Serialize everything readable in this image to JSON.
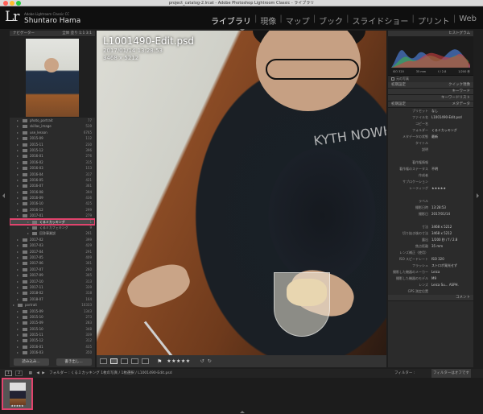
{
  "window": {
    "title": "project_catalog-2.lrcat - Adobe Photoshop Lightroom Classic - ライブラリ"
  },
  "identity": {
    "app_name": "Adobe Lightroom Classic CC",
    "user_name": "Shuntaro Hama"
  },
  "modules": [
    {
      "label": "ライブラリ",
      "active": true
    },
    {
      "label": "現像",
      "active": false
    },
    {
      "label": "マップ",
      "active": false
    },
    {
      "label": "ブック",
      "active": false
    },
    {
      "label": "スライドショー",
      "active": false
    },
    {
      "label": "プリント",
      "active": false
    },
    {
      "label": "Web",
      "active": false
    }
  ],
  "navigator": {
    "title": "ナビゲーター",
    "fit": "全体",
    "fill": "塗り",
    "one": "1:1",
    "zoom": "3:1"
  },
  "folders": [
    {
      "name": "photo_portrait",
      "count": "77",
      "level": 1
    },
    {
      "name": "skillas_image",
      "count": "519",
      "level": 1
    },
    {
      "name": "use_lesson",
      "count": "6765",
      "level": 1
    },
    {
      "name": "2015-09",
      "count": "112",
      "level": 1
    },
    {
      "name": "2015-11",
      "count": "230",
      "level": 1
    },
    {
      "name": "2015-12",
      "count": "396",
      "level": 1
    },
    {
      "name": "2016-01",
      "count": "276",
      "level": 1
    },
    {
      "name": "2016-02",
      "count": "315",
      "level": 1
    },
    {
      "name": "2016-03",
      "count": "153",
      "level": 1
    },
    {
      "name": "2016-04",
      "count": "317",
      "level": 1
    },
    {
      "name": "2016-05",
      "count": "421",
      "level": 1
    },
    {
      "name": "2016-07",
      "count": "361",
      "level": 1
    },
    {
      "name": "2016-08",
      "count": "394",
      "level": 1
    },
    {
      "name": "2016-09",
      "count": "436",
      "level": 1
    },
    {
      "name": "2016-10",
      "count": "425",
      "level": 1
    },
    {
      "name": "2016-12",
      "count": "299",
      "level": 1
    },
    {
      "name": "2017-01",
      "count": "279",
      "level": 1
    },
    {
      "name": "くるミカッキング",
      "count": "1",
      "level": 2,
      "highlight": true
    },
    {
      "name": "くるミカフェキング",
      "count": "9",
      "level": 2
    },
    {
      "name": "回答事業説",
      "count": "261",
      "level": 2
    },
    {
      "name": "2017-02",
      "count": "399",
      "level": 1
    },
    {
      "name": "2017-03",
      "count": "429",
      "level": 1
    },
    {
      "name": "2017-04",
      "count": "291",
      "level": 1
    },
    {
      "name": "2017-05",
      "count": "409",
      "level": 1
    },
    {
      "name": "2017-06",
      "count": "301",
      "level": 1
    },
    {
      "name": "2017-07",
      "count": "260",
      "level": 1
    },
    {
      "name": "2017-09",
      "count": "305",
      "level": 1
    },
    {
      "name": "2017-10",
      "count": "313",
      "level": 1
    },
    {
      "name": "2017-11",
      "count": "339",
      "level": 1
    },
    {
      "name": "2018-02",
      "count": "318",
      "level": 1
    },
    {
      "name": "2018-07",
      "count": "164",
      "level": 1
    },
    {
      "name": "portrait",
      "count": "10333",
      "level": 0
    },
    {
      "name": "2015-09",
      "count": "1343",
      "level": 1
    },
    {
      "name": "2015-10",
      "count": "273",
      "level": 1
    },
    {
      "name": "2015-09",
      "count": "283",
      "level": 1
    },
    {
      "name": "2015-10",
      "count": "348",
      "level": 1
    },
    {
      "name": "2015-11",
      "count": "339",
      "level": 1
    },
    {
      "name": "2015-12",
      "count": "312",
      "level": 1
    },
    {
      "name": "2016-01",
      "count": "435",
      "level": 1
    },
    {
      "name": "2016-03",
      "count": "350",
      "level": 1
    },
    {
      "name": "2016-04",
      "count": "354",
      "level": 1
    },
    {
      "name": "2016-05",
      "count": "421",
      "level": 1
    }
  ],
  "left_buttons": {
    "import": "読み込み...",
    "export": "書き出し..."
  },
  "histogram": {
    "title": "ヒストグラム",
    "iso": "ISO 320",
    "focal": "35 mm",
    "aperture": "f / 2.8",
    "shutter": "1/200 秒",
    "original": "元の写真"
  },
  "quick_develop": {
    "title": "クイック現像",
    "preset": "初期設定",
    "label": "保存したプリセット"
  },
  "keywording": {
    "title": "キーワード"
  },
  "keyword_list": {
    "title": "キーワードリスト"
  },
  "metadata": {
    "title": "メタデータ",
    "preset_label": "初期設定",
    "preset_lab": "プリセット",
    "preset_val": "なし",
    "rows": [
      {
        "label": "ファイル名",
        "value": "L1001490-Edit.psd"
      },
      {
        "label": "コピー名",
        "value": ""
      },
      {
        "label": "フォルダー",
        "value": "くるミカッキング"
      },
      {
        "label": "メタデータの状態",
        "value": "最新"
      },
      {
        "label": "タイトル",
        "value": ""
      },
      {
        "label": "説明",
        "value": ""
      },
      {
        "label": "",
        "value": ""
      },
      {
        "label": "著作権情報",
        "value": ""
      },
      {
        "label": "著作権のステータス",
        "value": "不明"
      },
      {
        "label": "作成者",
        "value": ""
      },
      {
        "label": "サブロケーション",
        "value": ""
      },
      {
        "label": "レーティング",
        "value": "★★★★★"
      },
      {
        "label": "",
        "value": ""
      },
      {
        "label": "ラベル",
        "value": ""
      },
      {
        "label": "撮影日時",
        "value": "13:28:53"
      },
      {
        "label": "撮影日",
        "value": "2017/01/14"
      },
      {
        "label": "",
        "value": ""
      },
      {
        "label": "寸法",
        "value": "3468 x 5212"
      },
      {
        "label": "切り抜き後の寸法",
        "value": "3468 x 5212"
      },
      {
        "label": "露出",
        "value": "1/200 秒 / f / 2.8"
      },
      {
        "label": "焦点距離",
        "value": "35 mm"
      },
      {
        "label": "レンズ補正（使用）",
        "value": ""
      },
      {
        "label": "ISO スピードレート",
        "value": "ISO 320"
      },
      {
        "label": "フラッシュ",
        "value": "ストロボ発光せず"
      },
      {
        "label": "撮影した機器のメーカー",
        "value": "Leica"
      },
      {
        "label": "撮影した機器のモデル",
        "value": "M9"
      },
      {
        "label": "レンズ",
        "value": "Leica Su... ASPH."
      },
      {
        "label": "GPS 測定位置",
        "value": ""
      }
    ]
  },
  "comments": {
    "title": "コメント"
  },
  "photo": {
    "filename": "L1001490-Edit.psd",
    "datetime": "2017/01/14 13:28:53",
    "dimensions": "3468 x 5212",
    "shirt_text": "KYTH NOWHY"
  },
  "toolbar": {
    "rating": "★★★★★"
  },
  "filmstrip": {
    "page1": "1",
    "page2": "2",
    "path": "フォルダー : くるミカッキング  1枚の写真 / 1枚選択 / L1001490-Edit.psd",
    "filter_label": "フィルター :",
    "filter_value": "フィルターはオフです",
    "thumb_stars": "★★★★★"
  },
  "colors": {
    "accent_highlight": "#e0446d",
    "panel": "#2b2b2b",
    "background": "#1e1e1e"
  }
}
